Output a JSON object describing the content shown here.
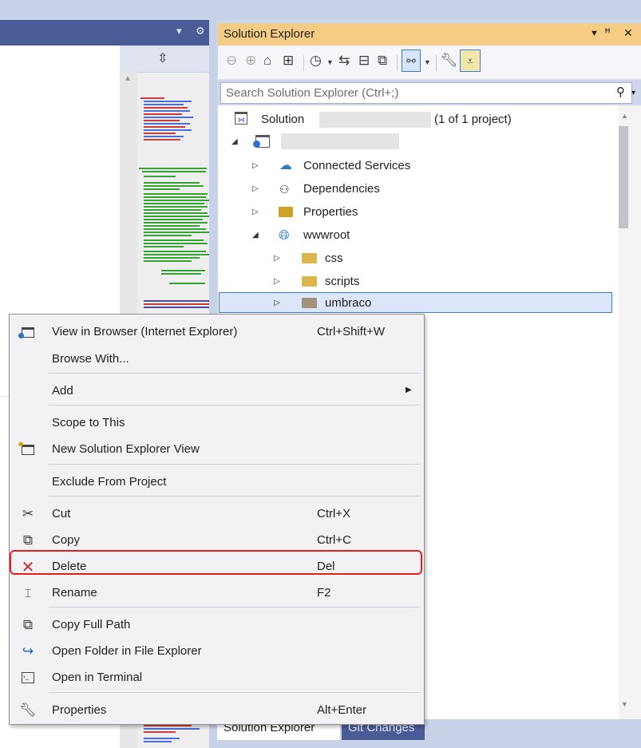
{
  "solution_explorer": {
    "title": "Solution Explorer",
    "search_placeholder": "Search Solution Explorer (Ctrl+;)",
    "tree": {
      "solution_label": "Solution",
      "solution_suffix": "(1 of 1 project)",
      "items": [
        {
          "label": "Connected Services",
          "icon": "cloud-gear-icon"
        },
        {
          "label": "Dependencies",
          "icon": "dependencies-icon"
        },
        {
          "label": "Properties",
          "icon": "wrench-folder-icon"
        },
        {
          "label": "wwwroot",
          "icon": "globe-icon"
        },
        {
          "label": "css",
          "icon": "folder-icon"
        },
        {
          "label": "scripts",
          "icon": "folder-icon"
        },
        {
          "label": "umbraco",
          "icon": "folder-icon"
        }
      ]
    },
    "bottom_tabs": [
      "Solution Explorer",
      "Git Changes"
    ]
  },
  "context_menu": {
    "items": [
      {
        "label": "View in Browser (Internet Explorer)",
        "shortcut": "Ctrl+Shift+W",
        "icon": "browser-icon"
      },
      {
        "label": "Browse With...",
        "shortcut": ""
      },
      {
        "label": "Add",
        "shortcut": "",
        "submenu": true
      },
      {
        "label": "Scope to This",
        "shortcut": ""
      },
      {
        "label": "New Solution Explorer View",
        "shortcut": "",
        "icon": "new-view-icon"
      },
      {
        "label": "Exclude From Project",
        "shortcut": ""
      },
      {
        "label": "Cut",
        "shortcut": "Ctrl+X",
        "icon": "scissors-icon"
      },
      {
        "label": "Copy",
        "shortcut": "Ctrl+C",
        "icon": "copy-icon"
      },
      {
        "label": "Delete",
        "shortcut": "Del",
        "icon": "delete-x-icon"
      },
      {
        "label": "Rename",
        "shortcut": "F2",
        "icon": "rename-icon"
      },
      {
        "label": "Copy Full Path",
        "shortcut": "",
        "icon": "copy-path-icon"
      },
      {
        "label": "Open Folder in File Explorer",
        "shortcut": "",
        "icon": "open-folder-arrow-icon"
      },
      {
        "label": "Open in Terminal",
        "shortcut": "",
        "icon": "terminal-icon"
      },
      {
        "label": "Properties",
        "shortcut": "Alt+Enter",
        "icon": "wrench-icon"
      }
    ]
  },
  "colors": {
    "title_bar": "#f5cc84",
    "highlight_border": "#e02020",
    "selected_row": "#dbe6f8"
  }
}
